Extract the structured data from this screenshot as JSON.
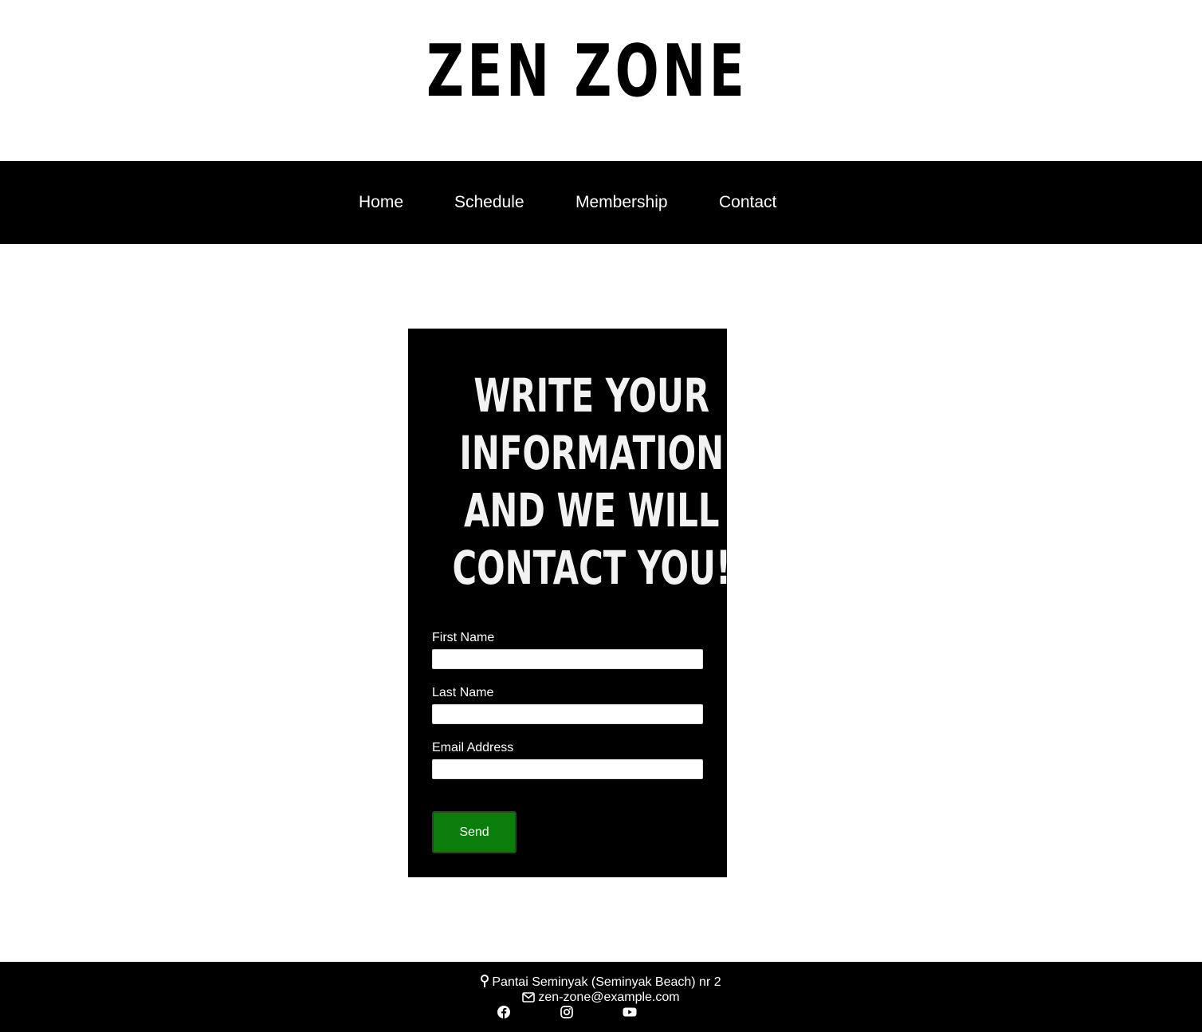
{
  "header": {
    "brand": "ZEN ZONE"
  },
  "nav": {
    "items": [
      {
        "label": "Home"
      },
      {
        "label": "Schedule"
      },
      {
        "label": "Membership"
      },
      {
        "label": "Contact"
      }
    ]
  },
  "form": {
    "heading_lines": [
      "WRITE YOUR",
      "INFORMATION",
      "AND WE WILL",
      "CONTACT YOU!"
    ],
    "fields": [
      {
        "label": "First Name",
        "value": ""
      },
      {
        "label": "Last Name",
        "value": ""
      },
      {
        "label": "Email Address",
        "value": ""
      }
    ],
    "submit_label": "Send"
  },
  "footer": {
    "address": "Pantai Seminyak (Seminyak Beach) nr 2",
    "email": "zen-zone@example.com",
    "icons": [
      "map-pin-icon",
      "envelope-icon",
      "facebook-icon",
      "instagram-icon",
      "youtube-icon"
    ]
  },
  "colors": {
    "nav_bg": "#000000",
    "card_bg": "#000000",
    "button_bg": "#0a7d0a",
    "footer_bg": "#000000"
  }
}
